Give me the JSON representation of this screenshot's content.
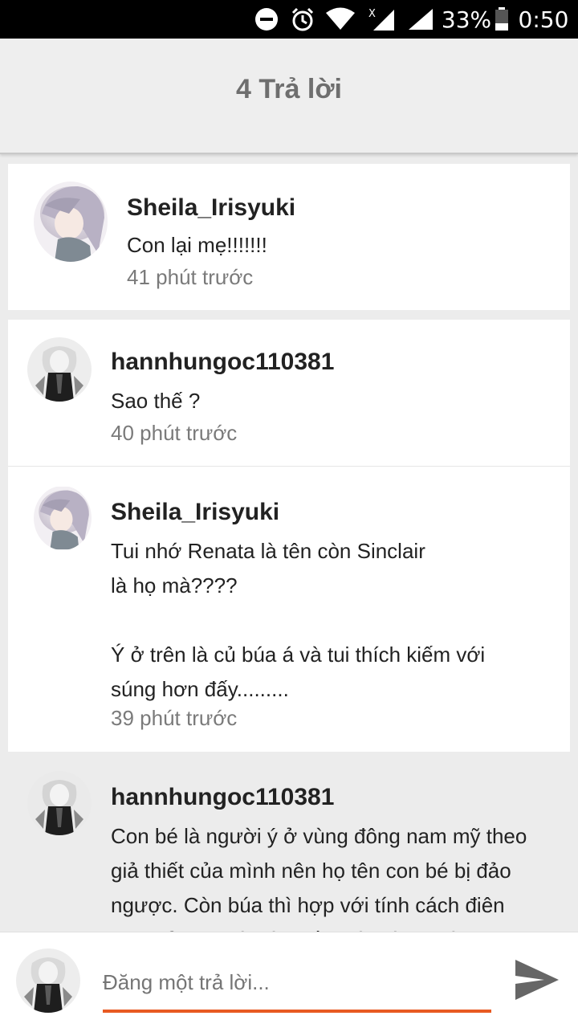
{
  "status_bar": {
    "battery": "33%",
    "time": "0:50",
    "icons": [
      "do-not-disturb-icon",
      "alarm-icon",
      "wifi-icon",
      "signal-no-data-icon",
      "signal-icon",
      "battery-icon"
    ]
  },
  "header": {
    "title": "4 Trả lời"
  },
  "main_comment": {
    "username": "Sheila_Irisyuki",
    "text": "Con lại mẹ!!!!!!!",
    "time": "41 phút trước"
  },
  "replies": [
    {
      "username": "hannhungoc110381",
      "text": "Sao thế ?",
      "time": "40 phút trước"
    },
    {
      "username": "Sheila_Irisyuki",
      "text": "Tui nhớ Renata là tên còn Sinclair\nlà họ mà????\n\nÝ ở trên là củ búa á và tui thích kiếm với\nsúng hơn đấy.........",
      "time": "39 phút trước"
    },
    {
      "username": "hannhungoc110381",
      "text": "Con bé là người ý ở vùng đông nam mỹ theo\ngiả thiết của mình nên họ tên con bé bị đảo\nngược. Còn búa thì hợp với tính cách điên\nloạn của cô bé mà, kiếm với súng mới",
      "time": ""
    }
  ],
  "reply_bar": {
    "placeholder": "Đăng một trả lời..."
  },
  "colors": {
    "accent": "#e85a22",
    "header_bg": "#eeeeee",
    "page_bg": "#ececec"
  }
}
